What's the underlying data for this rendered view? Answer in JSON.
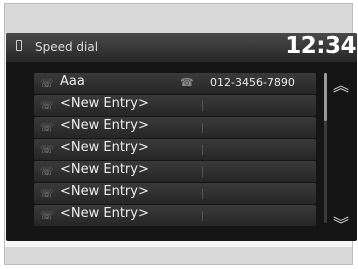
{
  "header": {
    "title": "Speed dial",
    "clock": "12:34"
  },
  "entries": [
    {
      "name": "Aaa",
      "number": "012-3456-7890"
    },
    {
      "name": "<New Entry>",
      "number": ""
    },
    {
      "name": "<New Entry>",
      "number": ""
    },
    {
      "name": "<New Entry>",
      "number": ""
    },
    {
      "name": "<New Entry>",
      "number": ""
    },
    {
      "name": "<New Entry>",
      "number": ""
    },
    {
      "name": "<New Entry>",
      "number": ""
    }
  ],
  "icons": {
    "header": "phone-icon",
    "row": "handset-icon",
    "number": "phone-number-icon",
    "scroll_up": "chevron-up-icon",
    "scroll_down": "chevron-down-icon"
  }
}
